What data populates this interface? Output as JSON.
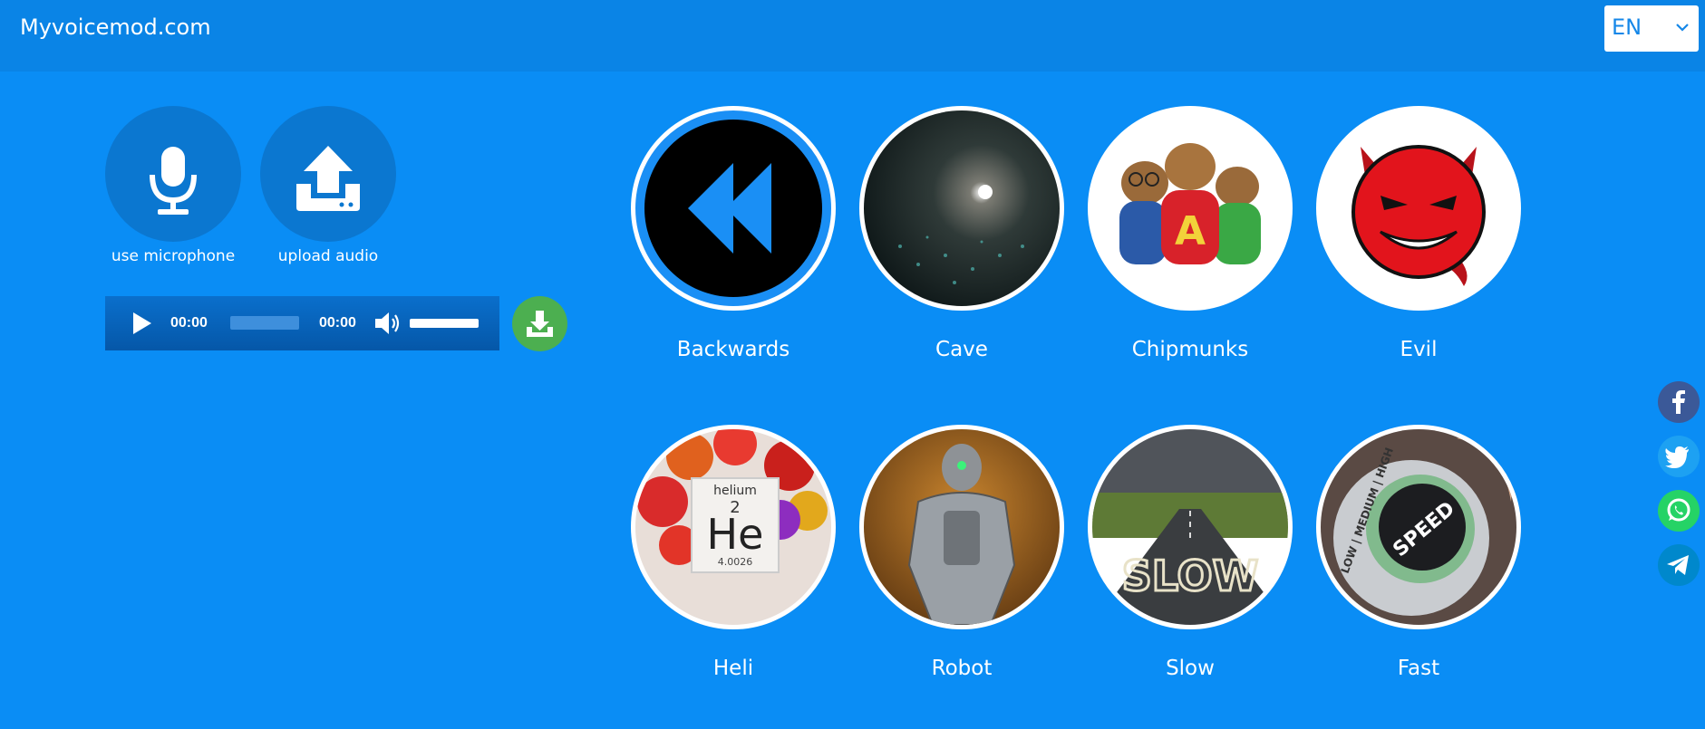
{
  "header": {
    "brand": "Myvoicemod.com",
    "language": "EN"
  },
  "inputs": {
    "microphone_label": "use microphone",
    "upload_label": "upload audio"
  },
  "player": {
    "current_time": "00:00",
    "duration": "00:00",
    "progress": 0,
    "volume": 1.0
  },
  "effects": [
    {
      "label": "Backwards"
    },
    {
      "label": "Cave"
    },
    {
      "label": "Chipmunks"
    },
    {
      "label": "Evil"
    },
    {
      "label": "Heli"
    },
    {
      "label": "Robot"
    },
    {
      "label": "Slow"
    },
    {
      "label": "Fast"
    }
  ],
  "effect_art": {
    "heli_element_name": "helium",
    "heli_atomic_number": "2",
    "heli_symbol": "He",
    "heli_mass": "4.0026",
    "slow_road_text": "SLOW",
    "fast_knob_text": "SPEED",
    "fast_dial_levels": "LOW | MEDIUM | HIGH",
    "chipmunk_letter": "A"
  },
  "social": [
    {
      "icon": "facebook-icon",
      "color": "#3b5998"
    },
    {
      "icon": "twitter-icon",
      "color": "#1da1f2"
    },
    {
      "icon": "whatsapp-icon",
      "color": "#25d366"
    },
    {
      "icon": "telegram-icon",
      "color": "#0088cc"
    }
  ],
  "colors": {
    "background": "#0a8df5",
    "header": "#0a84e6",
    "button": "#0b77d0",
    "download": "#4caf50"
  }
}
